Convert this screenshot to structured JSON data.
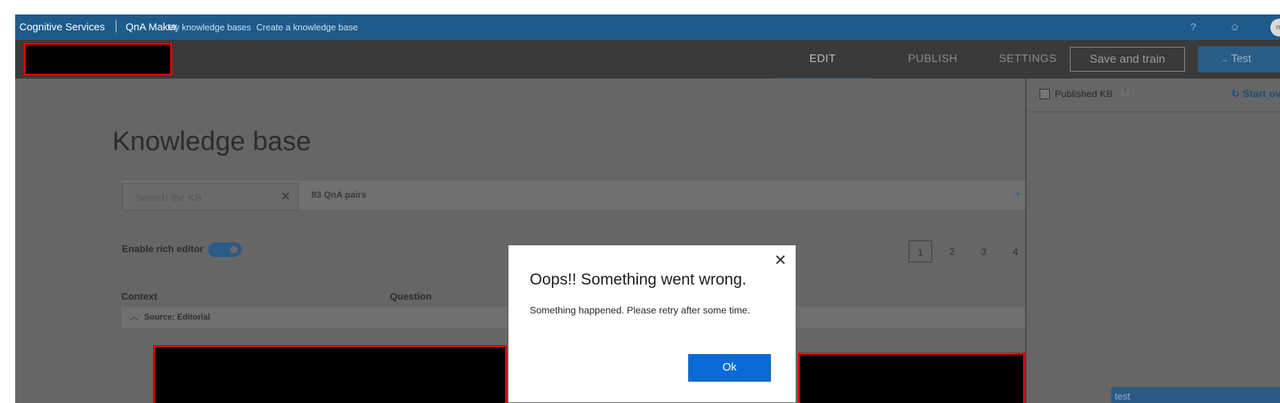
{
  "topbar": {
    "brand": "Cognitive Services",
    "product": "QnA Maker",
    "nav": [
      "My knowledge bases",
      "Create a knowledge base"
    ],
    "help_icon": "?",
    "feedback_icon": "☺",
    "avatar": "m"
  },
  "header": {
    "tabs": [
      "EDIT",
      "PUBLISH",
      "SETTINGS"
    ],
    "active_tab": "EDIT",
    "save_label": "Save and train",
    "test_label": "Test",
    "test_icon": "→"
  },
  "main": {
    "title": "Knowledge base",
    "search_placeholder": "Search the KB",
    "search_clear_icon": "✕",
    "pair_count": "83 QnA pairs",
    "add_icon": "+",
    "rich_editor_label": "Enable rich editor",
    "rich_editor_on": true,
    "pages": [
      "1",
      "2",
      "3",
      "4"
    ],
    "active_page": "1",
    "columns": [
      "Context",
      "Question"
    ],
    "source_label": "Source: Editorial",
    "source_chevron": "︿"
  },
  "test_panel": {
    "published_label": "Published KB",
    "published_help": "?",
    "start_over_icon": "↻",
    "start_over_label": "Start ov",
    "chat_message": "test"
  },
  "dialog": {
    "close_icon": "✕",
    "title": "Oops!! Something went wrong.",
    "message": "Something happened. Please retry after some time.",
    "ok_label": "Ok"
  },
  "colors": {
    "topbar": "#1e5b8c",
    "header": "#3a3a3a",
    "overlay": "#666666",
    "primary_button": "#0b6bd6",
    "redaction_border": "#e00000"
  }
}
